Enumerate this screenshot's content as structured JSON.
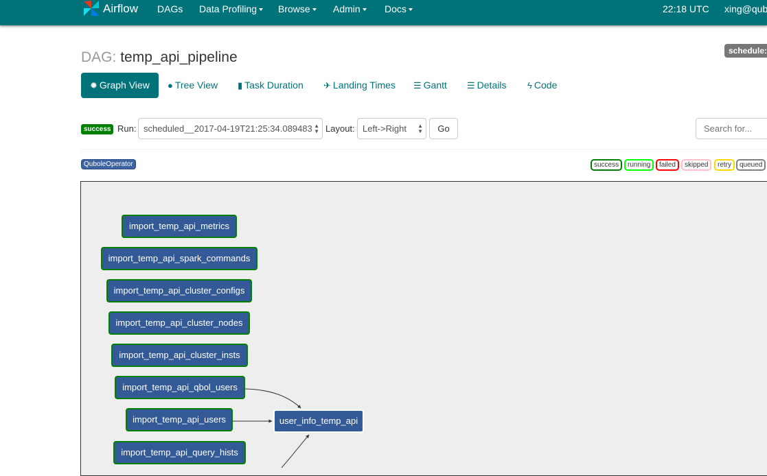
{
  "navbar": {
    "brand": "Airflow",
    "items": [
      "DAGs",
      "Data Profiling",
      "Browse",
      "Admin",
      "Docs"
    ],
    "time": "22:18 UTC",
    "user": "xing@qubo"
  },
  "header": {
    "title_prefix": "DAG:",
    "dag_name": "temp_api_pipeline",
    "schedule_badge": "schedule:"
  },
  "tabs": [
    {
      "label": "Graph View",
      "icon": "graph-icon",
      "active": true
    },
    {
      "label": "Tree View",
      "icon": "tree-icon"
    },
    {
      "label": "Task Duration",
      "icon": "bar-chart-icon"
    },
    {
      "label": "Landing Times",
      "icon": "plane-icon"
    },
    {
      "label": "Gantt",
      "icon": "gantt-icon"
    },
    {
      "label": "Details",
      "icon": "list-icon"
    },
    {
      "label": "Code",
      "icon": "flash-icon"
    }
  ],
  "controls": {
    "state_label": "success",
    "run_label": "Run:",
    "run_value": "scheduled__2017-04-19T21:25:34.089483",
    "layout_label": "Layout:",
    "layout_value": "Left->Right",
    "go_label": "Go",
    "search_placeholder": "Search for..."
  },
  "operator": "QuboleOperator",
  "legend": [
    {
      "label": "success",
      "color": "#008000"
    },
    {
      "label": "running",
      "color": "#00ff00"
    },
    {
      "label": "failed",
      "color": "#ff0000"
    },
    {
      "label": "skipped",
      "color": "#ffc0cb"
    },
    {
      "label": "retry",
      "color": "#ffd700"
    },
    {
      "label": "queued",
      "color": "#808080"
    }
  ],
  "nodes": [
    "import_temp_api_metrics",
    "import_temp_api_spark_commands",
    "import_temp_api_cluster_configs",
    "import_temp_api_cluster_nodes",
    "import_temp_api_cluster_insts",
    "import_temp_api_qbol_users",
    "import_temp_api_users",
    "import_temp_api_query_hists",
    "user_info_temp_api"
  ],
  "colors": {
    "navbar": "#00737a",
    "accent": "#00737a",
    "node_fill": "#335a96",
    "success_border": "#008000"
  }
}
